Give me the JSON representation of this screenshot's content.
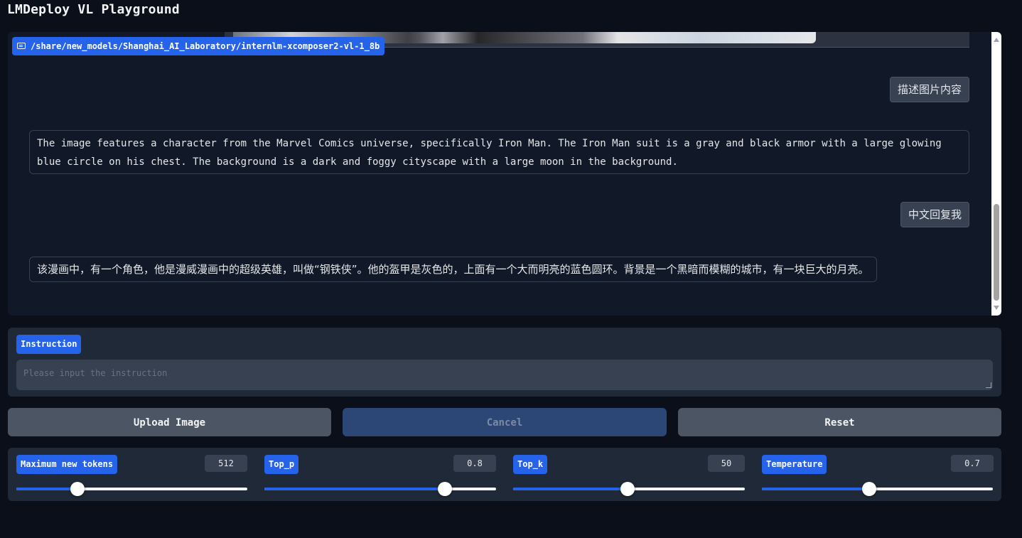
{
  "app": {
    "title": "LMDeploy VL Playground"
  },
  "chat": {
    "model_path": "/share/new_models/Shanghai_AI_Laboratory/internlm-xcomposer2-vl-1_8b",
    "messages": [
      {
        "role": "user",
        "text": "描述图片内容"
      },
      {
        "role": "assistant",
        "text": "The image features a character from the Marvel Comics universe, specifically Iron Man. The Iron Man suit is a gray and black armor with a large glowing blue circle on his chest. The background is a dark and foggy cityscape with a large moon in the background."
      },
      {
        "role": "user",
        "text": "中文回复我"
      },
      {
        "role": "assistant",
        "text": "该漫画中，有一个角色，他是漫威漫画中的超级英雄，叫做“钢铁侠”。他的盔甲是灰色的，上面有一个大而明亮的蓝色圆环。背景是一个黑暗而模糊的城市，有一块巨大的月亮。"
      }
    ]
  },
  "instruction": {
    "label": "Instruction",
    "placeholder": "Please input the instruction",
    "value": ""
  },
  "buttons": {
    "upload": "Upload Image",
    "cancel": "Cancel",
    "reset": "Reset"
  },
  "sliders": [
    {
      "label": "Maximum new tokens",
      "value": "512",
      "fraction": 0.265
    },
    {
      "label": "Top_p",
      "value": "0.8",
      "fraction": 0.78
    },
    {
      "label": "Top_k",
      "value": "50",
      "fraction": 0.495
    },
    {
      "label": "Temperature",
      "value": "0.7",
      "fraction": 0.465
    }
  ],
  "colors": {
    "accent": "#2563eb",
    "background": "#0b0f19",
    "panel": "#1f2937"
  },
  "icons": {
    "model_chip": "chat-bubble-icon"
  }
}
